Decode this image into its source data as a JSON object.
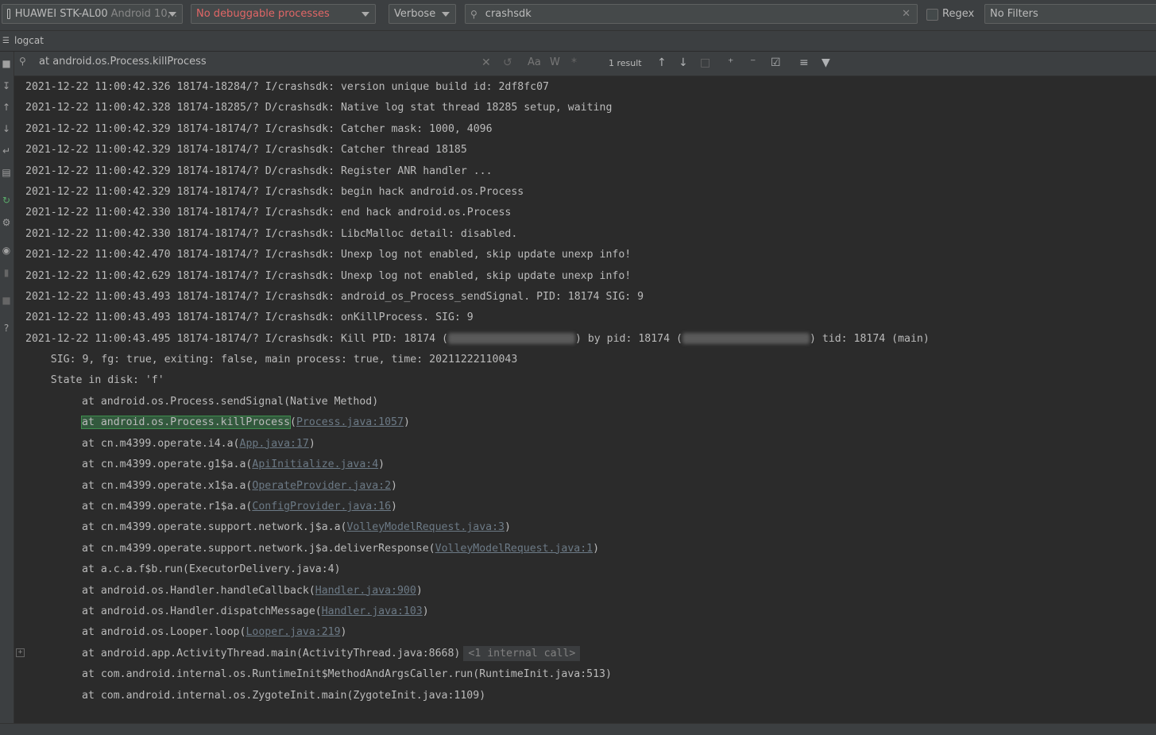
{
  "toolbar": {
    "device": "HUAWEI STK-AL00",
    "device_os": "Android 10, .",
    "process": "No debuggable processes",
    "level": "Verbose",
    "search_value": "crashsdk",
    "regex_label": "Regex",
    "filter": "No Filters"
  },
  "tab": {
    "label": "logcat"
  },
  "find": {
    "query": "at android.os.Process.killProcess",
    "case_label": "Aa",
    "word_label": "W",
    "result_count": "1 result"
  },
  "log": {
    "lines": [
      "2021-12-22 11:00:42.326 18174-18284/? I/crashsdk: version unique build id: 2df8fc07",
      "2021-12-22 11:00:42.328 18174-18285/? D/crashsdk: Native log stat thread 18285 setup, waiting",
      "2021-12-22 11:00:42.329 18174-18174/? I/crashsdk: Catcher mask: 1000, 4096",
      "2021-12-22 11:00:42.329 18174-18174/? I/crashsdk: Catcher thread 18185",
      "2021-12-22 11:00:42.329 18174-18174/? D/crashsdk: Register ANR handler ...",
      "2021-12-22 11:00:42.329 18174-18174/? I/crashsdk: begin hack android.os.Process",
      "2021-12-22 11:00:42.330 18174-18174/? I/crashsdk: end hack android.os.Process",
      "2021-12-22 11:00:42.330 18174-18174/? I/crashsdk: LibcMalloc detail: disabled.",
      "2021-12-22 11:00:42.470 18174-18174/? I/crashsdk: Unexp log not enabled, skip update unexp info!",
      "2021-12-22 11:00:42.629 18174-18174/? I/crashsdk: Unexp log not enabled, skip update unexp info!",
      "2021-12-22 11:00:43.493 18174-18174/? I/crashsdk: android_os_Process_sendSignal. PID: 18174 SIG: 9",
      "2021-12-22 11:00:43.493 18174-18174/? I/crashsdk: onKillProcess. SIG: 9"
    ],
    "kill_prefix": "2021-12-22 11:00:43.495 18174-18174/? I/crashsdk: Kill PID: 18174 (",
    "kill_mid": ") by pid: 18174 (",
    "kill_suffix": ") tid: 18174 (main)",
    "sig_line": "    SIG: 9, fg: true, exiting: false, main process: true, time: 20211222110043",
    "state_line": "    State in disk: 'f'",
    "stack": [
      {
        "text": "at android.os.Process.sendSignal(Native Method)",
        "link": "",
        "tail": ""
      },
      {
        "text": "(",
        "link": "Process.java:1057",
        "tail": ")",
        "highlight": "at android.os.Process.killProcess"
      },
      {
        "text": "at cn.m4399.operate.i4.a(",
        "link": "App.java:17",
        "tail": ")"
      },
      {
        "text": "at cn.m4399.operate.g1$a.a(",
        "link": "ApiInitialize.java:4",
        "tail": ")"
      },
      {
        "text": "at cn.m4399.operate.x1$a.a(",
        "link": "OperateProvider.java:2",
        "tail": ")"
      },
      {
        "text": "at cn.m4399.operate.r1$a.a(",
        "link": "ConfigProvider.java:16",
        "tail": ")"
      },
      {
        "text": "at cn.m4399.operate.support.network.j$a.a(",
        "link": "VolleyModelRequest.java:3",
        "tail": ")"
      },
      {
        "text": "at cn.m4399.operate.support.network.j$a.deliverResponse(",
        "link": "VolleyModelRequest.java:1",
        "tail": ")"
      },
      {
        "text": "at a.c.a.f$b.run(ExecutorDelivery.java:4)",
        "link": "",
        "tail": ""
      },
      {
        "text": "at android.os.Handler.handleCallback(",
        "link": "Handler.java:900",
        "tail": ")"
      },
      {
        "text": "at android.os.Handler.dispatchMessage(",
        "link": "Handler.java:103",
        "tail": ")"
      },
      {
        "text": "at android.os.Looper.loop(",
        "link": "Looper.java:219",
        "tail": ")"
      },
      {
        "text": "at android.app.ActivityThread.main(ActivityThread.java:8668)",
        "link": "",
        "tail": "",
        "internal": "<1 internal call>"
      },
      {
        "text": "at com.android.internal.os.RuntimeInit$MethodAndArgsCaller.run(RuntimeInit.java:513)",
        "link": "",
        "tail": ""
      },
      {
        "text": "at com.android.internal.os.ZygoteInit.main(ZygoteInit.java:1109)",
        "link": "",
        "tail": ""
      }
    ]
  },
  "colors": {
    "background": "#2b2b2b",
    "panel": "#3c3f41",
    "text": "#bbbbbb",
    "highlight": "#32593d",
    "no_process": "#e06666"
  }
}
